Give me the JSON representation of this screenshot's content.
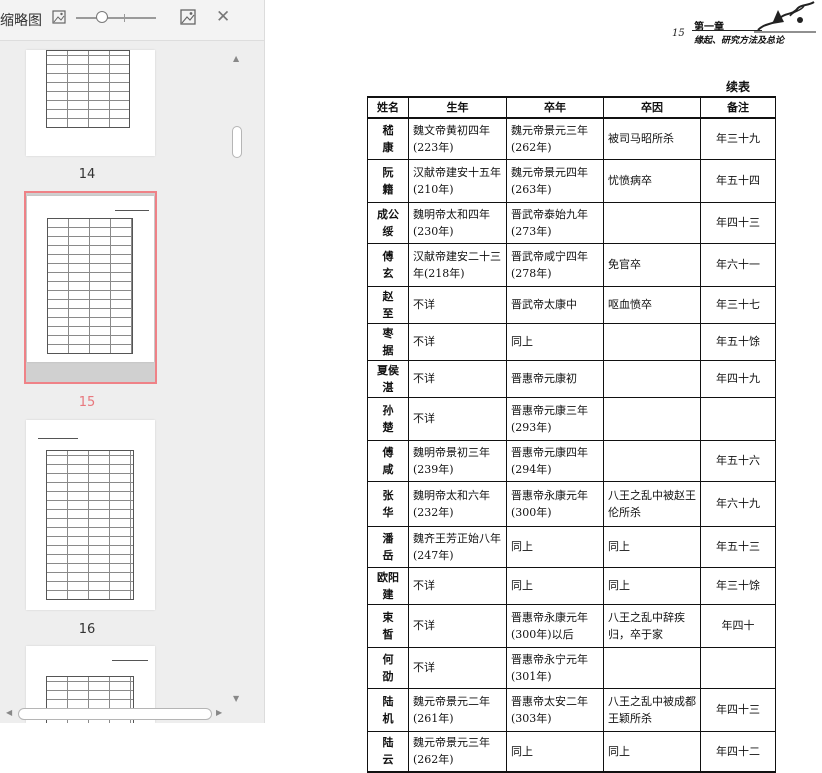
{
  "sidebar": {
    "title": "缩略图",
    "zoom_out_icon": "image-small-icon",
    "zoom_in_icon": "image-large-icon",
    "close_icon": "close-icon",
    "pages": [
      {
        "number": "14",
        "selected": false
      },
      {
        "number": "15",
        "selected": true
      },
      {
        "number": "16",
        "selected": false
      }
    ],
    "accent_color": "#ef8287"
  },
  "document": {
    "header": {
      "page_number": "15",
      "chapter": "第一章",
      "subtitle": "缘起、研究方法及总论"
    },
    "continued_label": "续表",
    "table": {
      "columns": [
        "姓名",
        "生年",
        "卒年",
        "卒因",
        "备注"
      ],
      "rows": [
        {
          "name": "嵇　康",
          "birth": "魏文帝黄初四年(223年)",
          "death": "魏元帝景元三年(262年)",
          "cause": "被司马昭所杀",
          "note": "年三十九"
        },
        {
          "name": "阮　籍",
          "birth": "汉献帝建安十五年(210年)",
          "death": "魏元帝景元四年(263年)",
          "cause": "忧愤病卒",
          "note": "年五十四"
        },
        {
          "name": "成公绥",
          "birth": "魏明帝太和四年(230年)",
          "death": "晋武帝泰始九年(273年)",
          "cause": "",
          "note": "年四十三"
        },
        {
          "name": "傅　玄",
          "birth": "汉献帝建安二十三年(218年)",
          "death": "晋武帝咸宁四年(278年)",
          "cause": "免官卒",
          "note": "年六十一"
        },
        {
          "name": "赵　至",
          "birth": "不详",
          "death": "晋武帝太康中",
          "cause": "呕血愤卒",
          "note": "年三十七"
        },
        {
          "name": "枣　据",
          "birth": "不详",
          "death": "同上",
          "cause": "",
          "note": "年五十馀"
        },
        {
          "name": "夏侯湛",
          "birth": "不详",
          "death": "晋惠帝元康初",
          "cause": "",
          "note": "年四十九"
        },
        {
          "name": "孙　楚",
          "birth": "不详",
          "death": "晋惠帝元康三年(293年)",
          "cause": "",
          "note": ""
        },
        {
          "name": "傅　咸",
          "birth": "魏明帝景初三年(239年)",
          "death": "晋惠帝元康四年(294年)",
          "cause": "",
          "note": "年五十六"
        },
        {
          "name": "张　华",
          "birth": "魏明帝太和六年(232年)",
          "death": "晋惠帝永康元年(300年)",
          "cause": "八王之乱中被赵王伦所杀",
          "note": "年六十九"
        },
        {
          "name": "潘　岳",
          "birth": "魏齐王芳正始八年(247年)",
          "death": "同上",
          "cause": "同上",
          "note": "年五十三"
        },
        {
          "name": "欧阳建",
          "birth": "不详",
          "death": "同上",
          "cause": "同上",
          "note": "年三十馀"
        },
        {
          "name": "束　皙",
          "birth": "不详",
          "death": "晋惠帝永康元年(300年)以后",
          "cause": "八王之乱中辞疾归，卒于家",
          "note": "年四十"
        },
        {
          "name": "何　劭",
          "birth": "不详",
          "death": "晋惠帝永宁元年(301年)",
          "cause": "",
          "note": ""
        },
        {
          "name": "陆　机",
          "birth": "魏元帝景元二年(261年)",
          "death": "晋惠帝太安二年(303年)",
          "cause": "八王之乱中被成都王颖所杀",
          "note": "年四十三"
        },
        {
          "name": "陆　云",
          "birth": "魏元帝景元三年(262年)",
          "death": "同上",
          "cause": "同上",
          "note": "年四十二"
        }
      ]
    }
  }
}
